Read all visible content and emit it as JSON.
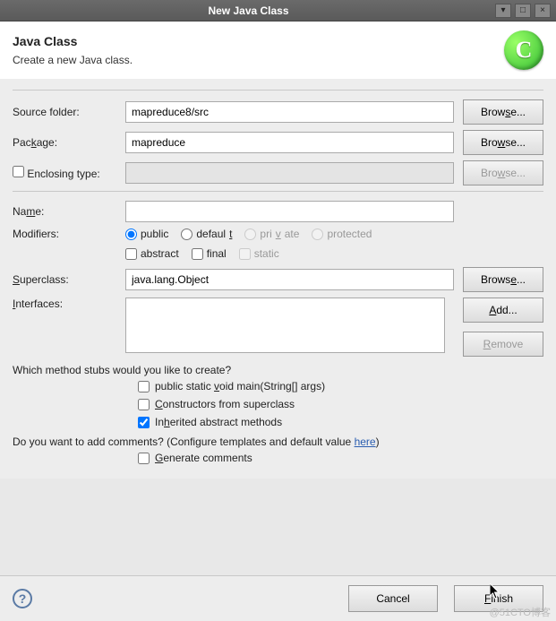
{
  "titlebar": {
    "title": "New Java Class"
  },
  "header": {
    "heading": "Java Class",
    "sub": "Create a new Java class.",
    "icon_letter": "C"
  },
  "fields": {
    "source_folder_label": "Source folder:",
    "source_folder_value": "mapreduce8/src",
    "package_label_pre": "Pac",
    "package_label_u": "k",
    "package_label_post": "age:",
    "package_value": "mapreduce",
    "enclosing_label": "Enclosing type:",
    "name_label_pre": "Na",
    "name_label_u": "m",
    "name_label_post": "e:",
    "name_value": "",
    "modifiers_label": "Modifiers:",
    "superclass_label_u": "S",
    "superclass_label_post": "uperclass:",
    "superclass_value": "java.lang.Object",
    "interfaces_label_u": "I",
    "interfaces_label_post": "nterfaces:"
  },
  "modifiers": {
    "public": "public",
    "default_pre": "defaul",
    "default_u": "t",
    "private_pre": "pri",
    "private_u": "v",
    "private_post": "ate",
    "protected": "protected",
    "abstract": "abstract",
    "final": "final",
    "static": "static"
  },
  "buttons": {
    "browse_pre": "Brow",
    "browse_u": "s",
    "browse_post": "e...",
    "browse2_pre": "Bro",
    "browse2_u": "w",
    "browse2_post": "se...",
    "browse3_pre": "Brows",
    "browse3_u": "e",
    "browse3_post": "...",
    "add_u": "A",
    "add_post": "dd...",
    "remove_u": "R",
    "remove_post": "emove",
    "cancel": "Cancel",
    "finish_u": "F",
    "finish_post": "inish"
  },
  "stubs": {
    "question": "Which method stubs would you like to create?",
    "main_pre": "public static ",
    "main_u": "v",
    "main_post": "oid main(String[] args)",
    "ctor_u": "C",
    "ctor_post": "onstructors from superclass",
    "inh_pre": "In",
    "inh_u": "h",
    "inh_post": "erited abstract methods"
  },
  "comments": {
    "question_pre": "Do you want to add comments? (Configure templates and default value ",
    "here": "here",
    "question_post": ")",
    "gen_u": "G",
    "gen_post": "enerate comments"
  },
  "watermark": "@51CTO博客"
}
